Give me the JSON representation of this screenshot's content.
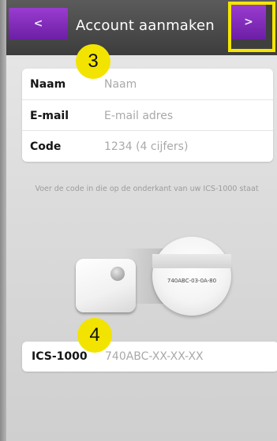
{
  "header": {
    "back_label": "<",
    "next_label": ">",
    "title": "Account aanmaken"
  },
  "annotations": {
    "step_3": "3",
    "step_4": "4"
  },
  "form": {
    "name_label": "Naam",
    "name_placeholder": "Naam",
    "email_label": "E-mail",
    "email_placeholder": "E-mail adres",
    "code_label": "Code",
    "code_placeholder": "1234 (4 cijfers)"
  },
  "instruction": "Voer de code in die op de onderkant van uw ICS-1000 staat",
  "device_illustration": {
    "serial_label": "740ABC-03-0A-80"
  },
  "ics": {
    "label": "ICS-1000",
    "placeholder": "740ABC-XX-XX-XX"
  },
  "colors": {
    "accent_purple": "#7b2bb8",
    "highlight_yellow": "#f4e600",
    "header_dark": "#474747"
  }
}
